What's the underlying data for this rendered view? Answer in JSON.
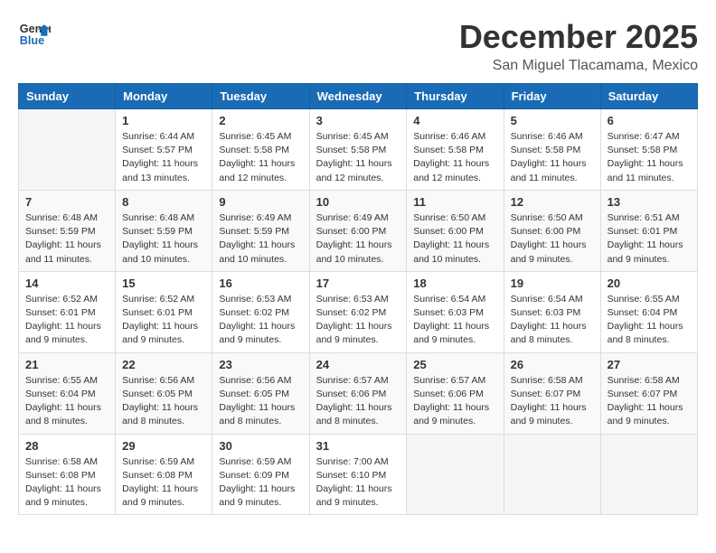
{
  "header": {
    "logo": {
      "line1": "General",
      "line2": "Blue"
    },
    "title": "December 2025",
    "location": "San Miguel Tlacamama, Mexico"
  },
  "weekdays": [
    "Sunday",
    "Monday",
    "Tuesday",
    "Wednesday",
    "Thursday",
    "Friday",
    "Saturday"
  ],
  "weeks": [
    [
      {
        "day": "",
        "info": ""
      },
      {
        "day": "1",
        "info": "Sunrise: 6:44 AM\nSunset: 5:57 PM\nDaylight: 11 hours\nand 13 minutes."
      },
      {
        "day": "2",
        "info": "Sunrise: 6:45 AM\nSunset: 5:58 PM\nDaylight: 11 hours\nand 12 minutes."
      },
      {
        "day": "3",
        "info": "Sunrise: 6:45 AM\nSunset: 5:58 PM\nDaylight: 11 hours\nand 12 minutes."
      },
      {
        "day": "4",
        "info": "Sunrise: 6:46 AM\nSunset: 5:58 PM\nDaylight: 11 hours\nand 12 minutes."
      },
      {
        "day": "5",
        "info": "Sunrise: 6:46 AM\nSunset: 5:58 PM\nDaylight: 11 hours\nand 11 minutes."
      },
      {
        "day": "6",
        "info": "Sunrise: 6:47 AM\nSunset: 5:58 PM\nDaylight: 11 hours\nand 11 minutes."
      }
    ],
    [
      {
        "day": "7",
        "info": "Sunrise: 6:48 AM\nSunset: 5:59 PM\nDaylight: 11 hours\nand 11 minutes."
      },
      {
        "day": "8",
        "info": "Sunrise: 6:48 AM\nSunset: 5:59 PM\nDaylight: 11 hours\nand 10 minutes."
      },
      {
        "day": "9",
        "info": "Sunrise: 6:49 AM\nSunset: 5:59 PM\nDaylight: 11 hours\nand 10 minutes."
      },
      {
        "day": "10",
        "info": "Sunrise: 6:49 AM\nSunset: 6:00 PM\nDaylight: 11 hours\nand 10 minutes."
      },
      {
        "day": "11",
        "info": "Sunrise: 6:50 AM\nSunset: 6:00 PM\nDaylight: 11 hours\nand 10 minutes."
      },
      {
        "day": "12",
        "info": "Sunrise: 6:50 AM\nSunset: 6:00 PM\nDaylight: 11 hours\nand 9 minutes."
      },
      {
        "day": "13",
        "info": "Sunrise: 6:51 AM\nSunset: 6:01 PM\nDaylight: 11 hours\nand 9 minutes."
      }
    ],
    [
      {
        "day": "14",
        "info": "Sunrise: 6:52 AM\nSunset: 6:01 PM\nDaylight: 11 hours\nand 9 minutes."
      },
      {
        "day": "15",
        "info": "Sunrise: 6:52 AM\nSunset: 6:01 PM\nDaylight: 11 hours\nand 9 minutes."
      },
      {
        "day": "16",
        "info": "Sunrise: 6:53 AM\nSunset: 6:02 PM\nDaylight: 11 hours\nand 9 minutes."
      },
      {
        "day": "17",
        "info": "Sunrise: 6:53 AM\nSunset: 6:02 PM\nDaylight: 11 hours\nand 9 minutes."
      },
      {
        "day": "18",
        "info": "Sunrise: 6:54 AM\nSunset: 6:03 PM\nDaylight: 11 hours\nand 9 minutes."
      },
      {
        "day": "19",
        "info": "Sunrise: 6:54 AM\nSunset: 6:03 PM\nDaylight: 11 hours\nand 8 minutes."
      },
      {
        "day": "20",
        "info": "Sunrise: 6:55 AM\nSunset: 6:04 PM\nDaylight: 11 hours\nand 8 minutes."
      }
    ],
    [
      {
        "day": "21",
        "info": "Sunrise: 6:55 AM\nSunset: 6:04 PM\nDaylight: 11 hours\nand 8 minutes."
      },
      {
        "day": "22",
        "info": "Sunrise: 6:56 AM\nSunset: 6:05 PM\nDaylight: 11 hours\nand 8 minutes."
      },
      {
        "day": "23",
        "info": "Sunrise: 6:56 AM\nSunset: 6:05 PM\nDaylight: 11 hours\nand 8 minutes."
      },
      {
        "day": "24",
        "info": "Sunrise: 6:57 AM\nSunset: 6:06 PM\nDaylight: 11 hours\nand 8 minutes."
      },
      {
        "day": "25",
        "info": "Sunrise: 6:57 AM\nSunset: 6:06 PM\nDaylight: 11 hours\nand 9 minutes."
      },
      {
        "day": "26",
        "info": "Sunrise: 6:58 AM\nSunset: 6:07 PM\nDaylight: 11 hours\nand 9 minutes."
      },
      {
        "day": "27",
        "info": "Sunrise: 6:58 AM\nSunset: 6:07 PM\nDaylight: 11 hours\nand 9 minutes."
      }
    ],
    [
      {
        "day": "28",
        "info": "Sunrise: 6:58 AM\nSunset: 6:08 PM\nDaylight: 11 hours\nand 9 minutes."
      },
      {
        "day": "29",
        "info": "Sunrise: 6:59 AM\nSunset: 6:08 PM\nDaylight: 11 hours\nand 9 minutes."
      },
      {
        "day": "30",
        "info": "Sunrise: 6:59 AM\nSunset: 6:09 PM\nDaylight: 11 hours\nand 9 minutes."
      },
      {
        "day": "31",
        "info": "Sunrise: 7:00 AM\nSunset: 6:10 PM\nDaylight: 11 hours\nand 9 minutes."
      },
      {
        "day": "",
        "info": ""
      },
      {
        "day": "",
        "info": ""
      },
      {
        "day": "",
        "info": ""
      }
    ]
  ]
}
